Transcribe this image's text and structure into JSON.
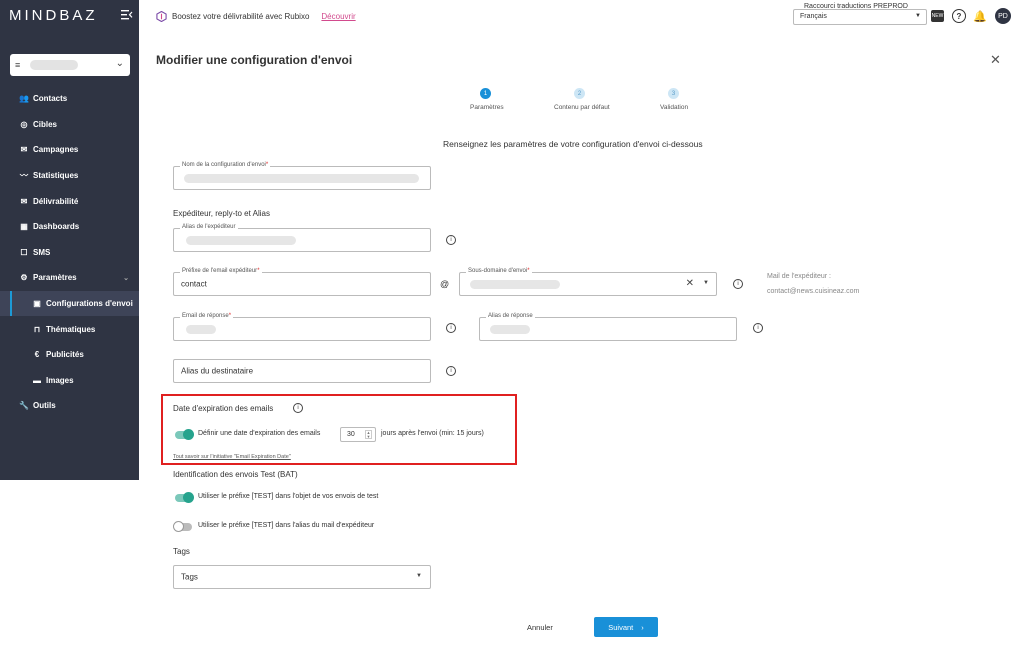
{
  "app": {
    "logo": "MINDBAZ"
  },
  "topbar": {
    "promo_text": "Boostez votre délivrabilité avec Rubixo",
    "promo_link": "Découvrir",
    "shortcut_label": "Raccourci traductions PREPROD",
    "language": "Français",
    "user_initials": "PD"
  },
  "sidebar": {
    "items": [
      {
        "label": "Contacts",
        "icon": "contacts-icon",
        "glyph": "👥"
      },
      {
        "label": "Cibles",
        "icon": "target-icon",
        "glyph": "◎"
      },
      {
        "label": "Campagnes",
        "icon": "mail-icon",
        "glyph": "✉"
      },
      {
        "label": "Statistiques",
        "icon": "chart-icon",
        "glyph": "〰"
      },
      {
        "label": "Délivrabilité",
        "icon": "deliverability-icon",
        "glyph": "✉"
      },
      {
        "label": "Dashboards",
        "icon": "dashboard-icon",
        "glyph": "▦"
      },
      {
        "label": "SMS",
        "icon": "sms-icon",
        "glyph": "☐"
      },
      {
        "label": "Paramètres",
        "icon": "gear-icon",
        "glyph": "⚙"
      },
      {
        "label": "Configurations d'envoi",
        "icon": "config-icon",
        "glyph": "▣"
      },
      {
        "label": "Thématiques",
        "icon": "bookmark-icon",
        "glyph": "⊓"
      },
      {
        "label": "Publicités",
        "icon": "euro-icon",
        "glyph": "€"
      },
      {
        "label": "Images",
        "icon": "image-icon",
        "glyph": "▬"
      },
      {
        "label": "Outils",
        "icon": "wrench-icon",
        "glyph": "🔧"
      }
    ]
  },
  "main": {
    "title": "Modifier une configuration d'envoi",
    "steps": [
      {
        "num": "1",
        "label": "Paramètres",
        "active": true
      },
      {
        "num": "2",
        "label": "Contenu par défaut",
        "active": false
      },
      {
        "num": "3",
        "label": "Validation",
        "active": false
      }
    ],
    "heading": "Renseignez les paramètres de votre configuration d'envoi ci-dessous",
    "config_name_label": "Nom de la configuration d'envoi",
    "section_sender": "Expéditeur, reply-to et Alias",
    "sender_alias_label": "Alias de l'expéditeur",
    "sender_prefix_label": "Préfixe de l'email expéditeur",
    "sender_prefix_value": "contact",
    "at_sign": "@",
    "subdomain_label": "Sous-domaine d'envoi",
    "mail_sender_label": "Mail de l'expéditeur :",
    "mail_sender_value": "contact@news.cuisineaz.com",
    "reply_email_label": "Email de réponse",
    "reply_alias_label": "Alias de réponse",
    "recipient_alias_placeholder": "Alias du destinataire",
    "expiry_title": "Date d'expiration des emails",
    "expiry_toggle_label": "Définir une date d'expiration des emails",
    "expiry_days": "30",
    "expiry_suffix": "jours après l'envoi (min: 15 jours)",
    "expiry_link": "Tout savoir sur l'initiative \"Email Expiration Date\"",
    "section_bat": "Identification des envois Test (BAT)",
    "bat_prefix_subject": "Utiliser le préfixe [TEST] dans l'objet de vos envois de test",
    "bat_prefix_alias": "Utiliser le préfixe [TEST] dans l'alias du mail d'expéditeur",
    "section_tags": "Tags",
    "tags_placeholder": "Tags",
    "cancel_label": "Annuler",
    "next_label": "Suivant"
  },
  "colors": {
    "sidebar_bg": "#2f3443",
    "accent": "#1990d8",
    "toggle_on": "#26a38d",
    "highlight": "#e02020",
    "promo_link": "#d24a8d"
  }
}
